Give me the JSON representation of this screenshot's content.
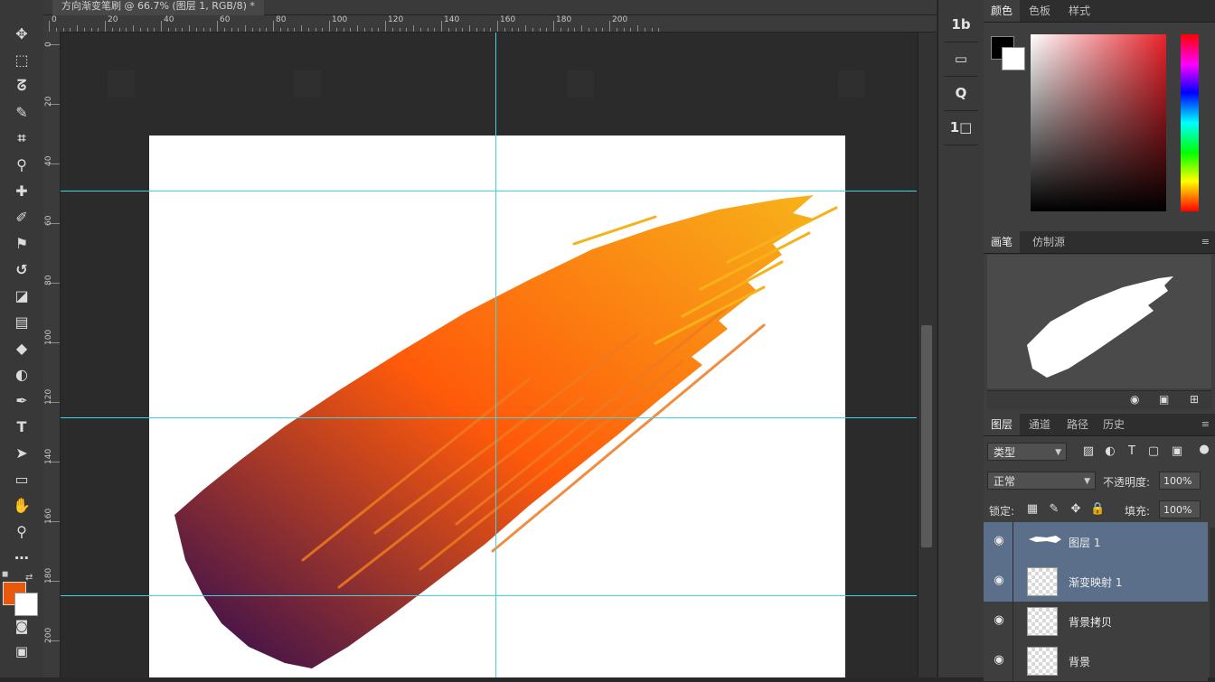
{
  "document": {
    "tab_label": "方向渐变笔刷 @ 66.7% (图层 1, RGB/8) *",
    "ruler_top_labels": [
      "0",
      "20",
      "40",
      "60",
      "80",
      "100",
      "120",
      "140",
      "160",
      "180",
      "200"
    ],
    "ruler_left_labels": [
      "0",
      "20",
      "40",
      "60",
      "80",
      "100",
      "120",
      "140",
      "160",
      "180",
      "200"
    ]
  },
  "colors": {
    "foreground": "#e8590d",
    "background": "#ffffff",
    "guide": "#40d4e6",
    "stroke_start": "#2a0a52",
    "stroke_mid": "#ff5a0a",
    "stroke_end": "#f7b21a",
    "selection": "#5b6f8a"
  },
  "tools": [
    {
      "name": "move-tool-icon",
      "glyph": "✥"
    },
    {
      "name": "marquee-tool-icon",
      "glyph": "⬚"
    },
    {
      "name": "lasso-tool-icon",
      "glyph": "ᘔ"
    },
    {
      "name": "quick-select-tool-icon",
      "glyph": "✎"
    },
    {
      "name": "crop-tool-icon",
      "glyph": "⌗"
    },
    {
      "name": "eyedropper-tool-icon",
      "glyph": "⚲"
    },
    {
      "name": "healing-brush-tool-icon",
      "glyph": "✚"
    },
    {
      "name": "brush-tool-icon",
      "glyph": "✐"
    },
    {
      "name": "clone-stamp-tool-icon",
      "glyph": "⚑"
    },
    {
      "name": "history-brush-tool-icon",
      "glyph": "↺"
    },
    {
      "name": "eraser-tool-icon",
      "glyph": "◪"
    },
    {
      "name": "gradient-tool-icon",
      "glyph": "▤"
    },
    {
      "name": "blur-tool-icon",
      "glyph": "◆"
    },
    {
      "name": "dodge-tool-icon",
      "glyph": "◐"
    },
    {
      "name": "pen-tool-icon",
      "glyph": "✒"
    },
    {
      "name": "type-tool-icon",
      "glyph": "T"
    },
    {
      "name": "path-select-tool-icon",
      "glyph": "➤"
    },
    {
      "name": "shape-tool-icon",
      "glyph": "▭"
    },
    {
      "name": "hand-tool-icon",
      "glyph": "✋"
    },
    {
      "name": "zoom-tool-icon",
      "glyph": "⚲"
    },
    {
      "name": "extra-tool-icon",
      "glyph": "⋯"
    }
  ],
  "dock": [
    {
      "name": "dock-history-button",
      "label": "1b"
    },
    {
      "name": "dock-brush-presets-button",
      "label": "▭"
    },
    {
      "name": "dock-search-button",
      "label": "Q"
    },
    {
      "name": "dock-properties-button",
      "label": "1□"
    }
  ],
  "color_panel": {
    "tabs": [
      "颜色",
      "色板",
      "样式"
    ],
    "active_tab": 0
  },
  "brush_panel": {
    "tabs": [
      "画笔",
      "仿制源"
    ],
    "active_tab": 0
  },
  "layers_panel": {
    "tabs": [
      "图层",
      "通道",
      "路径",
      "历史"
    ],
    "active_tab": 0,
    "filter_label": "类型",
    "blend_mode": "正常",
    "opacity_label": "不透明度:",
    "opacity_value": "100%",
    "lock_label": "锁定:",
    "fill_label": "填充:",
    "fill_value": "100%",
    "layers": [
      {
        "name": "图层 1",
        "selected": true,
        "kind": "brush"
      },
      {
        "name": "渐变映射 1",
        "selected": true,
        "kind": "adjust"
      },
      {
        "name": "背景拷贝",
        "selected": false,
        "kind": "empty"
      },
      {
        "name": "背景",
        "selected": false,
        "kind": "empty"
      }
    ]
  }
}
